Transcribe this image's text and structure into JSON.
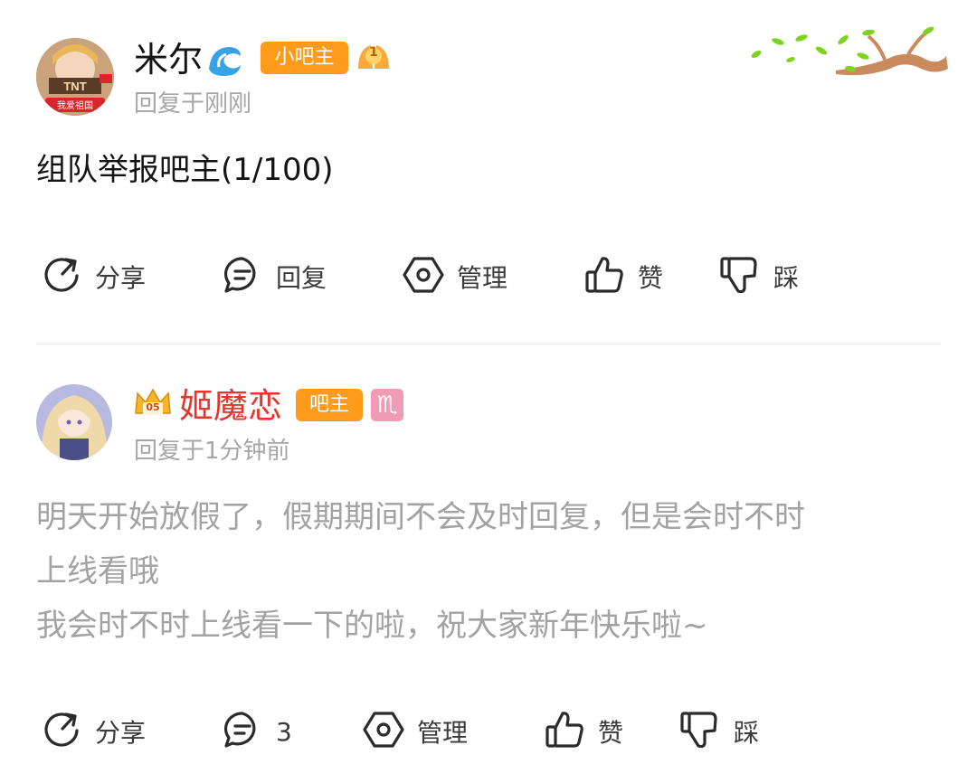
{
  "colors": {
    "accent": "#ff9b1a",
    "gray_text": "#a6a6a6",
    "red_name": "#e5352c",
    "icon": "#2b2b2b"
  },
  "posts": [
    {
      "username": "米尔",
      "badge": "小吧主",
      "level": "1",
      "reply_time": "回复于刚刚",
      "content": "组队举报吧主(1/100)",
      "avatar_caption": "我爱祖国",
      "avatar_logo": "TNT",
      "actions": {
        "share": "分享",
        "reply": "回复",
        "manage": "管理",
        "like": "赞",
        "dislike": "踩"
      }
    },
    {
      "username": "姬魔恋",
      "badge": "吧主",
      "crown_level": "05",
      "zodiac": "♏",
      "reply_time": "回复于1分钟前",
      "content": "明天开始放假了，假期期间不会及时回复，但是会时不时\n上线看哦\n我会时不时上线看一下的啦，祝大家新年快乐啦~",
      "actions": {
        "share": "分享",
        "reply_count": "3",
        "manage": "管理",
        "like": "赞",
        "dislike": "踩"
      }
    }
  ]
}
